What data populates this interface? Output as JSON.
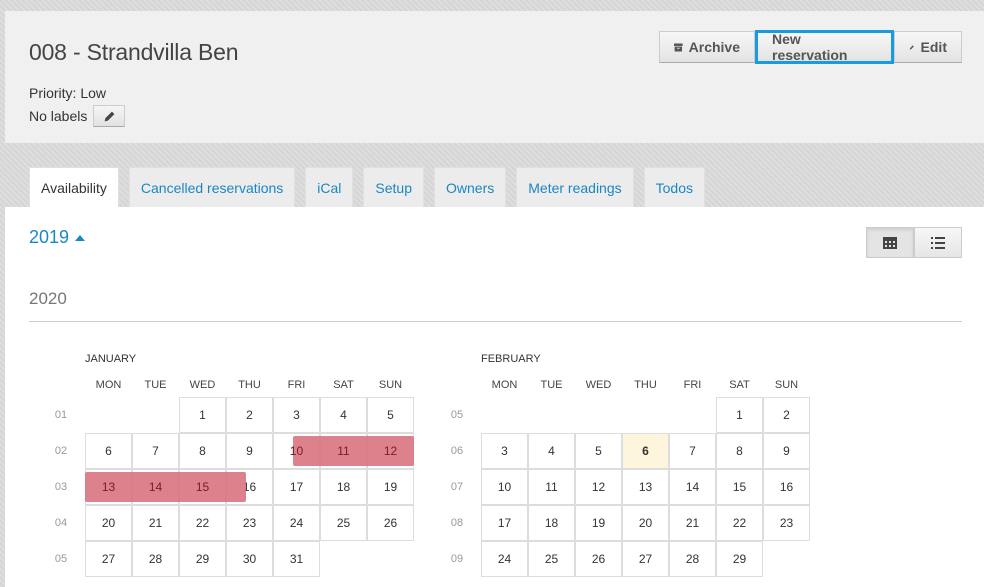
{
  "header": {
    "title": "008 - Strandvilla Ben",
    "priority": "Priority: Low",
    "labels": "No labels",
    "buttons": {
      "archive": "Archive",
      "new_reservation": "New reservation",
      "edit": "Edit"
    }
  },
  "tabs": [
    {
      "label": "Availability",
      "active": true
    },
    {
      "label": "Cancelled reservations"
    },
    {
      "label": "iCal"
    },
    {
      "label": "Setup"
    },
    {
      "label": "Owners"
    },
    {
      "label": "Meter readings"
    },
    {
      "label": "Todos"
    }
  ],
  "calendar": {
    "prev_year": "2019",
    "current_year": "2020",
    "accent_color": "#1a87c2",
    "reservation_color": "#d9737f",
    "days_of_week": [
      "MON",
      "TUE",
      "WED",
      "THU",
      "FRI",
      "SAT",
      "SUN"
    ],
    "months": [
      {
        "name": "JANUARY",
        "weeks": [
          {
            "week": "01",
            "days": [
              "",
              "",
              "1",
              "2",
              "3",
              "4",
              "5"
            ]
          },
          {
            "week": "02",
            "days": [
              "6",
              "7",
              "8",
              "9",
              "10",
              "11",
              "12"
            ]
          },
          {
            "week": "03",
            "days": [
              "13",
              "14",
              "15",
              "16",
              "17",
              "18",
              "19"
            ]
          },
          {
            "week": "04",
            "days": [
              "20",
              "21",
              "22",
              "23",
              "24",
              "25",
              "26"
            ]
          },
          {
            "week": "05",
            "days": [
              "27",
              "28",
              "29",
              "30",
              "31",
              "",
              ""
            ]
          }
        ],
        "reserved": [
          "10",
          "11",
          "12",
          "13",
          "14",
          "15"
        ]
      },
      {
        "name": "FEBRUARY",
        "weeks": [
          {
            "week": "05",
            "days": [
              "",
              "",
              "",
              "",
              "",
              "1",
              "2"
            ]
          },
          {
            "week": "06",
            "days": [
              "3",
              "4",
              "5",
              "6",
              "7",
              "8",
              "9"
            ]
          },
          {
            "week": "07",
            "days": [
              "10",
              "11",
              "12",
              "13",
              "14",
              "15",
              "16"
            ]
          },
          {
            "week": "08",
            "days": [
              "17",
              "18",
              "19",
              "20",
              "21",
              "22",
              "23"
            ]
          },
          {
            "week": "09",
            "days": [
              "24",
              "25",
              "26",
              "27",
              "28",
              "29",
              ""
            ]
          }
        ],
        "today": "6",
        "reserved": []
      }
    ]
  }
}
